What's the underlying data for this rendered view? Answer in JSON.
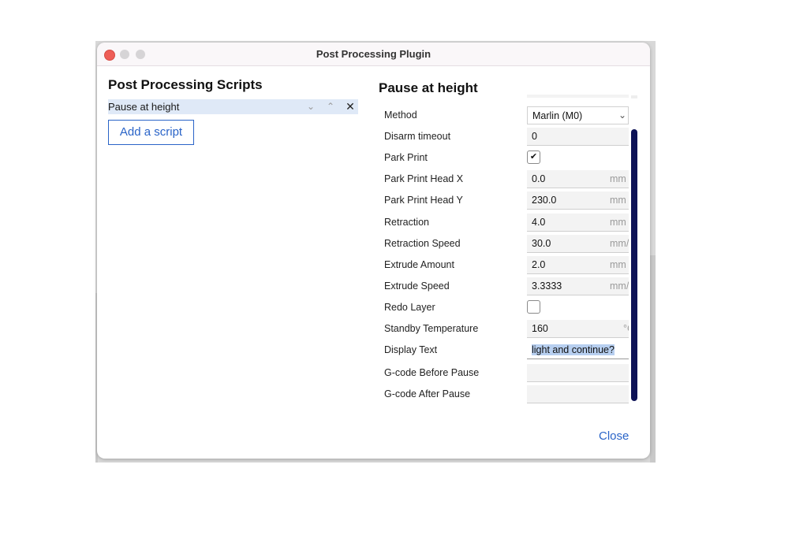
{
  "window": {
    "title": "Post Processing Plugin"
  },
  "left": {
    "heading": "Post Processing Scripts",
    "scripts": [
      {
        "label": "Pause at height"
      }
    ],
    "add_button": "Add a script"
  },
  "right": {
    "heading": "Pause at height",
    "settings": [
      {
        "label": "Method",
        "type": "select",
        "value": "Marlin (M0)"
      },
      {
        "label": "Disarm timeout",
        "type": "text",
        "value": "0",
        "unit": ""
      },
      {
        "label": "Park Print",
        "type": "checkbox",
        "checked": true
      },
      {
        "label": "Park Print Head X",
        "type": "text",
        "value": "0.0",
        "unit": "mm"
      },
      {
        "label": "Park Print Head Y",
        "type": "text",
        "value": "230.0",
        "unit": "mm"
      },
      {
        "label": "Retraction",
        "type": "text",
        "value": "4.0",
        "unit": "mm"
      },
      {
        "label": "Retraction Speed",
        "type": "text",
        "value": "30.0",
        "unit": "mm/s"
      },
      {
        "label": "Extrude Amount",
        "type": "text",
        "value": "2.0",
        "unit": "mm"
      },
      {
        "label": "Extrude Speed",
        "type": "text",
        "value": "3.3333",
        "unit": "mm/s"
      },
      {
        "label": "Redo Layer",
        "type": "checkbox",
        "checked": false
      },
      {
        "label": "Standby Temperature",
        "type": "text",
        "value": "160",
        "unit": "°C"
      },
      {
        "label": "Display Text",
        "type": "text",
        "value": "light and continue?",
        "unit": "",
        "selected": true
      },
      {
        "label": "G-code Before Pause",
        "type": "text",
        "value": "",
        "unit": ""
      },
      {
        "label": "G-code After Pause",
        "type": "text",
        "value": "",
        "unit": ""
      }
    ]
  },
  "footer": {
    "close_label": "Close"
  },
  "icons": {
    "move_down": "⌄",
    "move_up": "⌃",
    "remove": "✕",
    "checkmark": "✔",
    "dropdown": "⌄"
  }
}
